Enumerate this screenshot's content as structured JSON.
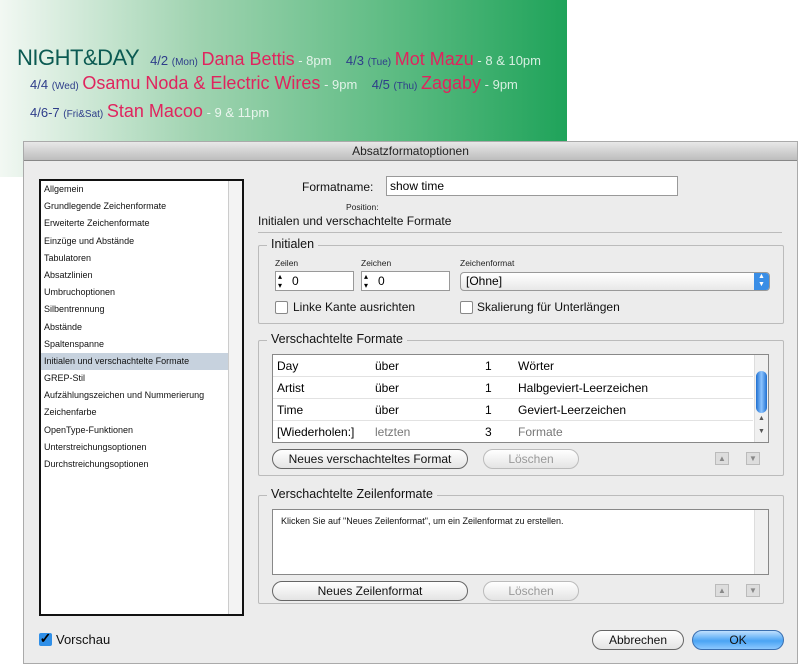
{
  "banner": {
    "logo": "NIGHT&DAY",
    "events": [
      {
        "date": "4/2",
        "day": "(Mon)",
        "artist": "Dana Bettis",
        "time": "- 8pm"
      },
      {
        "date": "4/3",
        "day": "(Tue)",
        "artist": "Mot Mazu",
        "time": "- 8 & 10pm"
      },
      {
        "date": "4/4",
        "day": "(Wed)",
        "artist": "Osamu Noda & Electric Wires",
        "time": "- 9pm"
      },
      {
        "date": "4/5",
        "day": "(Thu)",
        "artist": "Zagaby",
        "time": "- 9pm"
      },
      {
        "date": "4/6-7",
        "day": "(Fri&Sat)",
        "artist": "Stan Macoo",
        "time": "- 9 & 11pm"
      }
    ]
  },
  "dialog": {
    "title": "Absatzformatoptionen",
    "sidebar": [
      "Allgemein",
      "Grundlegende Zeichenformate",
      "Erweiterte Zeichenformate",
      "Einzüge und Abstände",
      "Tabulatoren",
      "Absatzlinien",
      "Umbruchoptionen",
      "Silbentrennung",
      "Abstände",
      "Spaltenspanne",
      "Initialen und verschachtelte Formate",
      "GREP-Stil",
      "Aufzählungszeichen und Nummerierung",
      "Zeichenfarbe",
      "OpenType-Funktionen",
      "Unterstreichungsoptionen",
      "Durchstreichungsoptionen"
    ],
    "selected_index": 10,
    "formatname_label": "Formatname:",
    "formatname_value": "show time",
    "position_label": "Position:",
    "section_title": "Initialen und verschachtelte Formate",
    "initialen": {
      "title": "Initialen",
      "zeilen_label": "Zeilen",
      "zeilen_value": "0",
      "zeichen_label": "Zeichen",
      "zeichen_value": "0",
      "zeichenformat_label": "Zeichenformat",
      "zeichenformat_value": "[Ohne]",
      "linke_kante": "Linke Kante ausrichten",
      "skalierung": "Skalierung für Unterlängen"
    },
    "verschachtelt": {
      "title": "Verschachtelte Formate",
      "rows": [
        [
          "Day",
          "über",
          "1",
          "Wörter"
        ],
        [
          "Artist",
          "über",
          "1",
          "Halbgeviert-Leerzeichen"
        ],
        [
          "Time",
          "über",
          "1",
          "Geviert-Leerzeichen"
        ],
        [
          "[Wiederholen:]",
          "letzten",
          "3",
          "Formate"
        ]
      ],
      "new_button": "Neues verschachteltes Format",
      "delete_button": "Löschen"
    },
    "zeilen": {
      "title": "Verschachtelte Zeilenformate",
      "hint": "Klicken Sie auf \"Neues Zeilenformat\", um ein Zeilenformat zu erstellen.",
      "new_button": "Neues Zeilenformat",
      "delete_button": "Löschen"
    },
    "preview_label": "Vorschau",
    "preview_checked": true,
    "cancel": "Abbrechen",
    "ok": "OK",
    "accent": "#2f8fe8"
  }
}
